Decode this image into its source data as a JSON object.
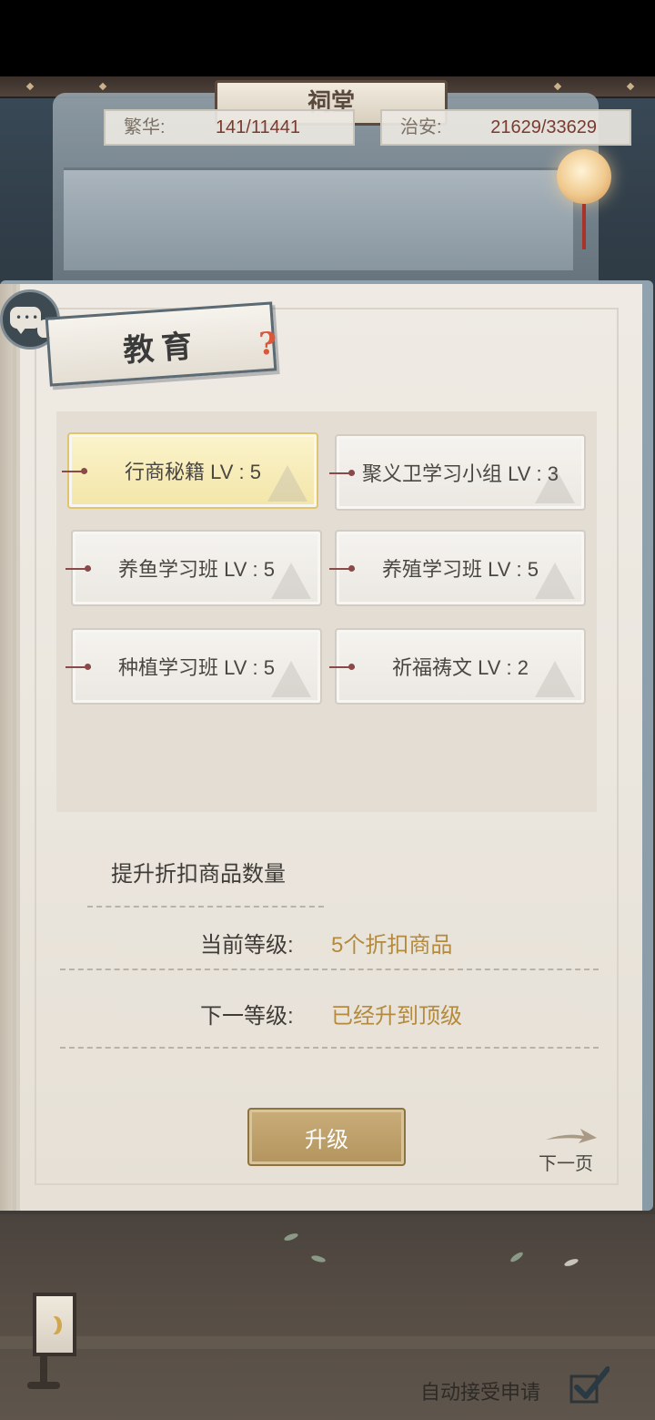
{
  "background": {
    "sign_text": "祠堂"
  },
  "stats": {
    "prosperity": {
      "label": "繁华:",
      "value": "141/11441"
    },
    "security": {
      "label": "治安:",
      "value": "21629/33629"
    }
  },
  "panel": {
    "title": "教育",
    "help_icon": "?",
    "skills": [
      {
        "label": "行商秘籍 LV : 5",
        "selected": true
      },
      {
        "label": "聚义卫学习小组 LV : 3",
        "selected": false
      },
      {
        "label": "养鱼学习班 LV : 5",
        "selected": false
      },
      {
        "label": "养殖学习班 LV : 5",
        "selected": false
      },
      {
        "label": "种植学习班 LV : 5",
        "selected": false
      },
      {
        "label": "祈福祷文 LV : 2",
        "selected": false
      }
    ],
    "description": {
      "title": "提升折扣商品数量",
      "current_label": "当前等级:",
      "current_value": "5个折扣商品",
      "next_label": "下一等级:",
      "next_value": "已经升到顶级"
    },
    "upgrade_label": "升级",
    "next_page_label": "下一页"
  },
  "footer": {
    "auto_accept_label": "自动接受申请",
    "auto_accept_checked": true
  },
  "colors": {
    "accent_gold": "#b48a3c",
    "button_gold": "#c2a26b",
    "selected_card": "#f3e6a8",
    "stat_value": "#7a3a2e"
  },
  "icons": {
    "chat": "chat-bubble-icon",
    "help": "question-mark-icon",
    "next": "arrow-right-icon",
    "check": "checkmark-icon",
    "lamp": "lantern-icon"
  }
}
